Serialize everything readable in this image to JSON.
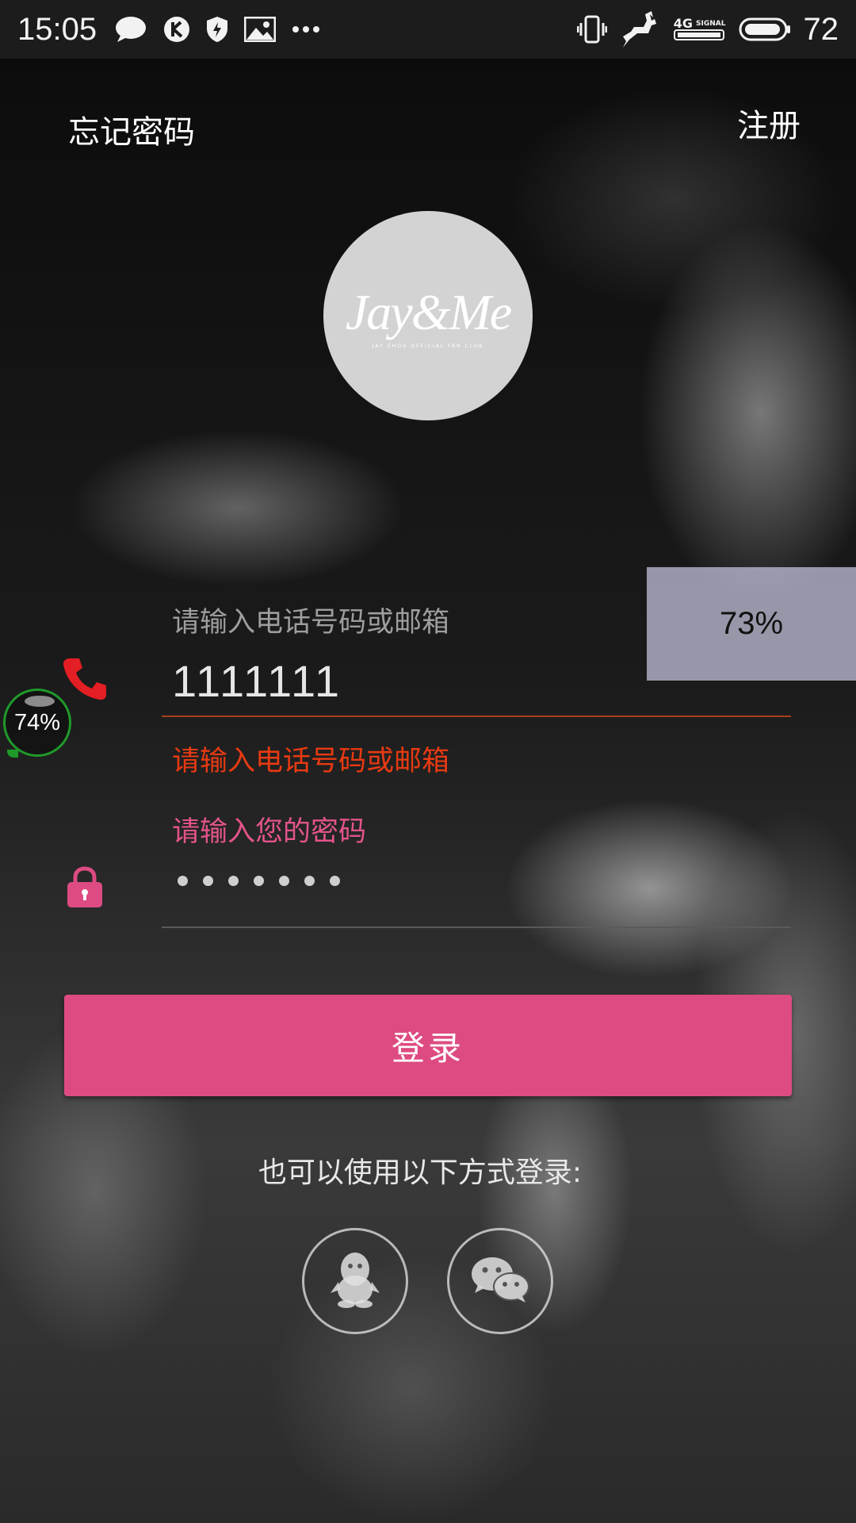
{
  "status_bar": {
    "time": "15:05",
    "left_icons": [
      "message-icon",
      "k-app-icon",
      "shield-icon",
      "image-icon",
      "more-icon"
    ],
    "right_icons": [
      "vibrate-icon",
      "deer-icon",
      "signal-4g-icon",
      "battery-icon"
    ],
    "signal_label_network": "4G",
    "signal_label_text": "SIGNAL",
    "battery_level": "72"
  },
  "header": {
    "forgot_password": "忘记密码",
    "register": "注册"
  },
  "logo": {
    "text": "Jay&Me",
    "subtitle": "JAY CHOU OFFICIAL FAN CLUB"
  },
  "overlay_percent": "73%",
  "floating_widget_percent": "74%",
  "form": {
    "phone_label": "请输入电话号码或邮箱",
    "phone_value": "1111111",
    "phone_error": "请输入电话号码或邮箱",
    "password_label": "请输入您的密码",
    "password_mask_count": 7
  },
  "login_button": "登录",
  "alt_login_text": "也可以使用以下方式登录:",
  "social": [
    "qq-icon",
    "wechat-icon"
  ],
  "colors": {
    "accent": "#dd4b82",
    "error": "#e83a12",
    "phone_icon": "#e31e24",
    "lock_icon": "#dd4b82"
  }
}
